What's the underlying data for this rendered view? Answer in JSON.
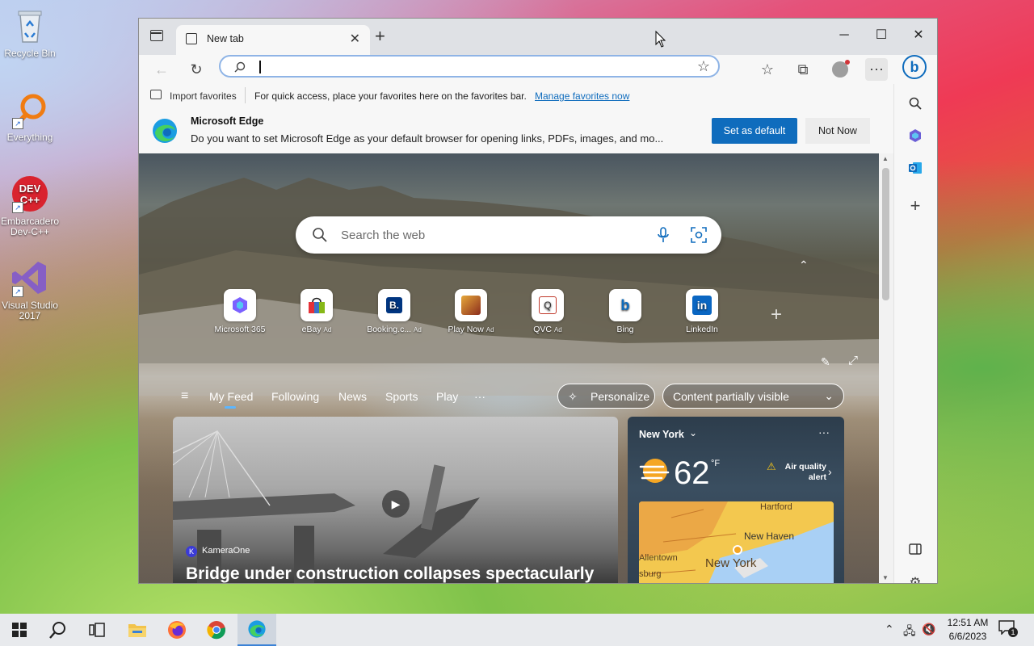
{
  "desktop": {
    "icons": [
      {
        "label": "Recycle Bin"
      },
      {
        "label": "Everything"
      },
      {
        "label": "Embarcadero Dev-C++"
      },
      {
        "label": "Visual Studio 2017"
      }
    ]
  },
  "browser": {
    "tab_title": "New tab",
    "address_value": "",
    "favorites_bar": {
      "import_label": "Import favorites",
      "message": "For quick access, place your favorites here on the favorites bar.",
      "link": "Manage favorites now"
    },
    "default_prompt": {
      "title": "Microsoft Edge",
      "message": "Do you want to set Microsoft Edge as your default browser for opening links, PDFs, images, and mo...",
      "primary": "Set as default",
      "secondary": "Not Now"
    },
    "new_tab_page": {
      "search_placeholder": "Search the web",
      "quick_links": [
        {
          "label": "Microsoft 365",
          "ad": ""
        },
        {
          "label": "eBay",
          "ad": "Ad"
        },
        {
          "label": "Booking.c...",
          "ad": "Ad"
        },
        {
          "label": "Play Now",
          "ad": "Ad"
        },
        {
          "label": "QVC",
          "ad": "Ad"
        },
        {
          "label": "Bing",
          "ad": ""
        },
        {
          "label": "LinkedIn",
          "ad": ""
        }
      ],
      "feed_tabs": [
        "My Feed",
        "Following",
        "News",
        "Sports",
        "Play"
      ],
      "personalize": "Personalize",
      "content_visibility": "Content partially visible",
      "article": {
        "source": "KameraOne",
        "source_initial": "K",
        "title": "Bridge under construction collapses spectacularly"
      },
      "weather": {
        "location": "New York",
        "temperature": "62",
        "unit": "°F",
        "alert": "Air quality alert",
        "map_labels": [
          "Hartford",
          "New Haven",
          "Allentown",
          "New York",
          "sburg"
        ]
      }
    }
  },
  "taskbar": {
    "time": "12:51 AM",
    "date": "6/6/2023",
    "notification_count": "1"
  },
  "colors": {
    "accent": "#0f6cbd",
    "taskbar": "#e8eaed"
  }
}
